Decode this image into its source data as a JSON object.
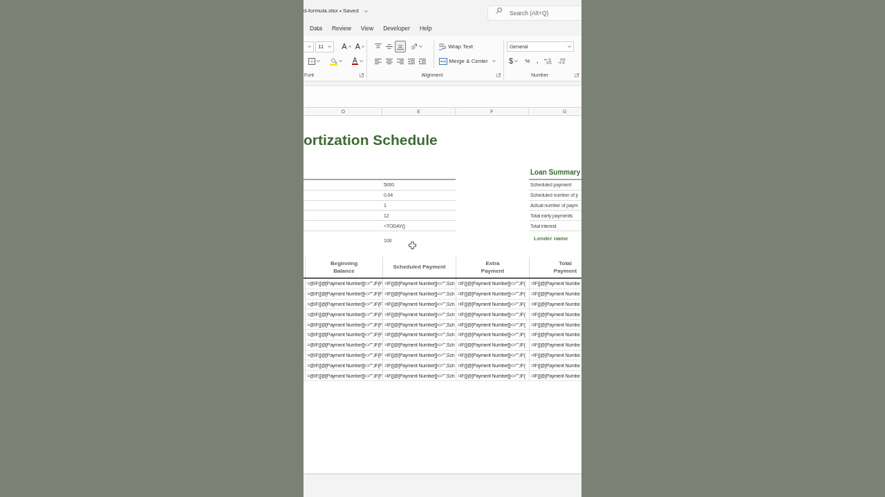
{
  "title_bar": {
    "file_name": "d-formula.xlsx • Saved",
    "search": {
      "placeholder": "Search (Alt+Q)"
    }
  },
  "menu_tabs": [
    {
      "label": "Data",
      "selected": false
    },
    {
      "label": "Review",
      "selected": false
    },
    {
      "label": "View",
      "selected": false
    },
    {
      "label": "Developer",
      "selected": false
    },
    {
      "label": "Help",
      "selected": false
    }
  ],
  "ribbon": {
    "font_group": {
      "font_size": "11",
      "grow_font": "A",
      "shrink_font": "A",
      "font_color": "A",
      "label": "Font"
    },
    "alignment_group": {
      "vertical_align": [
        {
          "kind": "top",
          "selected": false
        },
        {
          "kind": "middle",
          "selected": false
        },
        {
          "kind": "bottom",
          "selected": true
        }
      ],
      "horizontal_align": [
        {
          "kind": "left",
          "selected": false
        },
        {
          "kind": "center",
          "selected": false
        },
        {
          "kind": "right",
          "selected": false
        }
      ],
      "wrap_text": "Wrap Text",
      "merge_center": "Merge & Center",
      "label": "Alignment"
    },
    "number_group": {
      "format": "General",
      "currency": "$",
      "percent": "%",
      "comma": ",",
      "label": "Number"
    }
  },
  "sheet": {
    "column_headers": [
      "D",
      "E",
      "F",
      "G"
    ],
    "title": "ortization Schedule",
    "loan_inputs": [
      "5000",
      "0.04",
      "1",
      "12",
      "=TODAY()"
    ],
    "extra_payment": "100",
    "loan_summary": {
      "title": "Loan Summary",
      "rows": [
        "Scheduled payment",
        "Scheduled number of p",
        "Actual number of paym",
        "Total early payments",
        "Total interest"
      ]
    },
    "lender_label": "Lender name",
    "schedule": {
      "columns": [
        "Beginning\nBalance",
        "Scheduled Payment",
        "Extra\nPayment",
        "Total\nPayment"
      ],
      "rows": [
        [
          "=@IF([@[Payment Number]]<>\"\",IF(F",
          "=IF([@[Payment Number]]<>\"\",Sch",
          "=IF([@[Payment Number]]<>\"\",IF(",
          "=IF([@[Payment Numbe"
        ],
        [
          "=@IF([@[Payment Number]]<>\"\",IF(F",
          "=IF([@[Payment Number]]<>\"\",Sch",
          "=IF([@[Payment Number]]<>\"\",IF(",
          "=IF([@[Payment Numbe"
        ],
        [
          "=@IF([@[Payment Number]]<>\"\",IF(F",
          "=IF([@[Payment Number]]<>\"\",Sch",
          "=IF([@[Payment Number]]<>\"\",IF(",
          "=IF([@[Payment Numbe"
        ],
        [
          "=@IF([@[Payment Number]]<>\"\",IF(F",
          "=IF([@[Payment Number]]<>\"\",Sch",
          "=IF([@[Payment Number]]<>\"\",IF(",
          "=IF([@[Payment Numbe"
        ],
        [
          "=@IF([@[Payment Number]]<>\"\",IF(F",
          "=IF([@[Payment Number]]<>\"\",Sch",
          "=IF([@[Payment Number]]<>\"\",IF(",
          "=IF([@[Payment Numbe"
        ],
        [
          "=@IF([@[Payment Number]]<>\"\",IF(F",
          "=IF([@[Payment Number]]<>\"\",Sch",
          "=IF([@[Payment Number]]<>\"\",IF(",
          "=IF([@[Payment Numbe"
        ],
        [
          "=@IF([@[Payment Number]]<>\"\",IF(F",
          "=IF([@[Payment Number]]<>\"\",Sch",
          "=IF([@[Payment Number]]<>\"\",IF(",
          "=IF([@[Payment Numbe"
        ],
        [
          "=@IF([@[Payment Number]]<>\"\",IF(F",
          "=IF([@[Payment Number]]<>\"\",Sch",
          "=IF([@[Payment Number]]<>\"\",IF(",
          "=IF([@[Payment Numbe"
        ],
        [
          "=@IF([@[Payment Number]]<>\"\",IF(F",
          "=IF([@[Payment Number]]<>\"\",Sch",
          "=IF([@[Payment Number]]<>\"\",IF(",
          "=IF([@[Payment Numbe"
        ],
        [
          "=@IF([@[Payment Number]]<>\"\",IF(F",
          "=IF([@[Payment Number]]<>\"\",Sch",
          "=IF([@[Payment Number]]<>\"\",IF(",
          "=IF([@[Payment Numbe"
        ]
      ]
    }
  }
}
